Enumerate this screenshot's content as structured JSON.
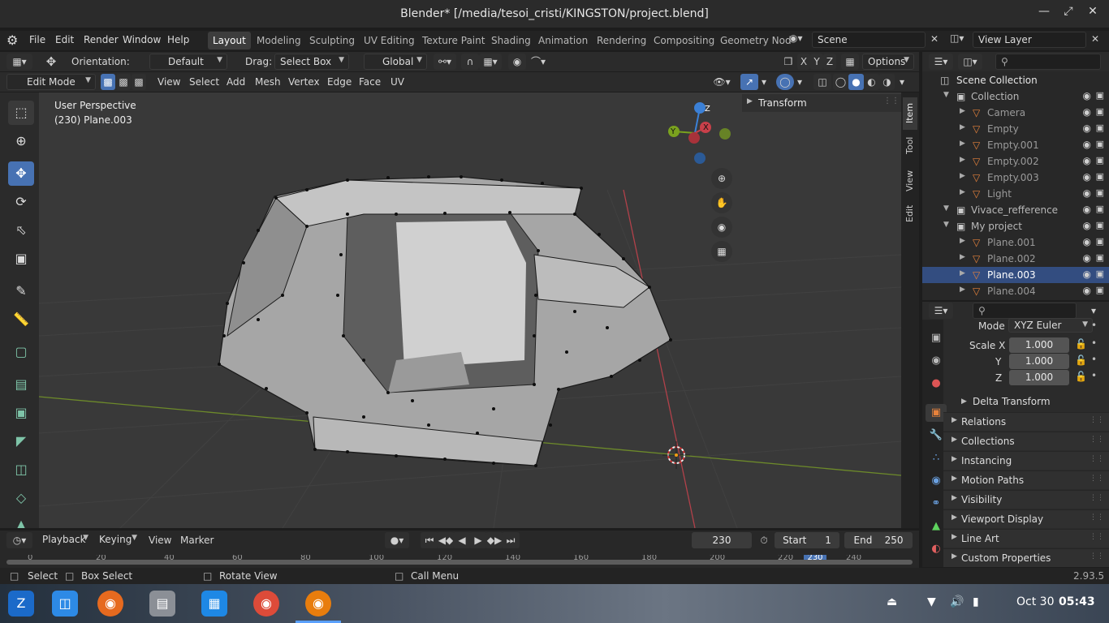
{
  "window": {
    "title": "Blender* [/media/tesoi_cristi/KINGSTON/project.blend]"
  },
  "menu": {
    "items": [
      "File",
      "Edit",
      "Render",
      "Window",
      "Help"
    ]
  },
  "workspaces": [
    "Layout",
    "Modeling",
    "Sculpting",
    "UV Editing",
    "Texture Paint",
    "Shading",
    "Animation",
    "Rendering",
    "Compositing",
    "Geometry Nod"
  ],
  "scene": {
    "name": "Scene",
    "view_layer": "View Layer"
  },
  "tool_header": {
    "orientation_label": "Orientation:",
    "orientation_value": "Default",
    "drag_label": "Drag:",
    "drag_value": "Select Box",
    "transform_orientation": "Global",
    "options_label": "Options"
  },
  "editor_header": {
    "mode": "Edit Mode",
    "menus": [
      "View",
      "Select",
      "Add",
      "Mesh",
      "Vertex",
      "Edge",
      "Face",
      "UV"
    ]
  },
  "viewport": {
    "perspective": "User Perspective",
    "object_info": "(230) Plane.003",
    "sidebar_panel": "Transform",
    "sidebar_tabs": [
      "Item",
      "Tool",
      "View",
      "Edit"
    ],
    "gizmo_axes": [
      "X",
      "Y",
      "Z"
    ]
  },
  "outliner": {
    "root": "Scene Collection",
    "rows": [
      {
        "name": "Collection",
        "indent": 1
      },
      {
        "name": "Camera",
        "indent": 2
      },
      {
        "name": "Empty",
        "indent": 2
      },
      {
        "name": "Empty.001",
        "indent": 2
      },
      {
        "name": "Empty.002",
        "indent": 2
      },
      {
        "name": "Empty.003",
        "indent": 2
      },
      {
        "name": "Light",
        "indent": 2
      },
      {
        "name": "Vivace_refference",
        "indent": 1
      },
      {
        "name": "My project",
        "indent": 1
      },
      {
        "name": "Plane.001",
        "indent": 2
      },
      {
        "name": "Plane.002",
        "indent": 2
      },
      {
        "name": "Plane.003",
        "indent": 2,
        "selected": true
      },
      {
        "name": "Plane.004",
        "indent": 2
      }
    ]
  },
  "properties": {
    "mode_label": "Mode",
    "mode_value": "XYZ Euler",
    "scale": [
      {
        "axis": "Scale X",
        "value": "1.000"
      },
      {
        "axis": "Y",
        "value": "1.000"
      },
      {
        "axis": "Z",
        "value": "1.000"
      }
    ],
    "delta": "Delta Transform",
    "panels": [
      "Relations",
      "Collections",
      "Instancing",
      "Motion Paths",
      "Visibility",
      "Viewport Display",
      "Line Art",
      "Custom Properties"
    ]
  },
  "timeline": {
    "menus": [
      "Playback",
      "Keying",
      "View",
      "Marker"
    ],
    "current_frame": "230",
    "start_label": "Start",
    "start_value": "1",
    "end_label": "End",
    "end_value": "250",
    "ruler": [
      "0",
      "20",
      "40",
      "60",
      "80",
      "100",
      "120",
      "140",
      "160",
      "180",
      "200",
      "220",
      "240"
    ],
    "ruler_current": "230"
  },
  "statusbar": {
    "select": "Select",
    "box_select": "Box Select",
    "rotate": "Rotate View",
    "call_menu": "Call Menu",
    "version": "2.93.5"
  },
  "taskbar": {
    "date": "Oct 30",
    "time": "05:43"
  },
  "colors": {
    "accent": "#4772b3",
    "header": "#2b2b2b",
    "viewport": "#393939",
    "x_axis": "#c8404a",
    "y_axis": "#7aa21e",
    "z_axis": "#3b80d6"
  }
}
